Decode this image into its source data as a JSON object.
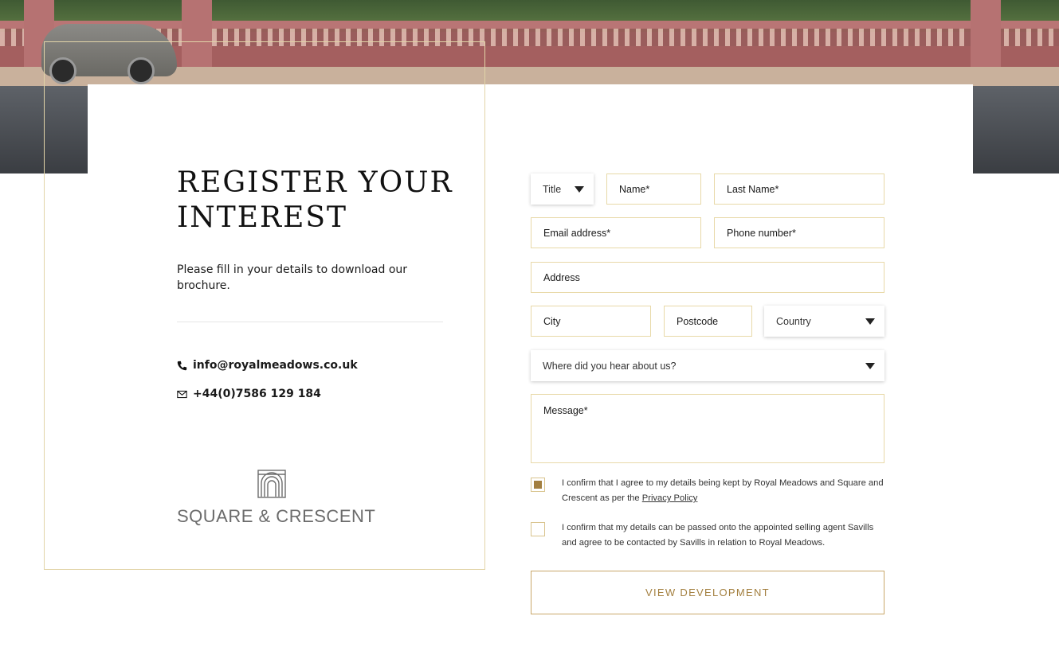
{
  "intro": {
    "heading_line1": "REGISTER YOUR",
    "heading_line2": "INTEREST",
    "text": "Please fill in your details to download our brochure."
  },
  "contacts": {
    "email": "info@royalmeadows.co.uk",
    "phone": "+44(0)7586 129 184"
  },
  "logo": {
    "text": "SQUARE & CRESCENT",
    "icon": "arch-logo-icon"
  },
  "form": {
    "title_select": "Title",
    "name_placeholder": "Name*",
    "last_name_placeholder": "Last Name*",
    "email_placeholder": "Email address*",
    "phone_placeholder": "Phone number*",
    "address_placeholder": "Address",
    "city_placeholder": "City",
    "postcode_placeholder": "Postcode",
    "country_select": "Country",
    "source_select": "Where did you hear about us?",
    "message_placeholder": "Message*",
    "consent1_text": "I confirm that I agree to my details being kept by Royal Meadows and Square and Crescent as per the",
    "consent1_link": "Privacy Policy",
    "consent1_checked": true,
    "consent2_text": "I confirm that my details can be passed onto the appointed selling agent Savills and agree to be contacted by Savills in relation to Royal Meadows.",
    "consent2_checked": false,
    "submit_label": "VIEW DEVELOPMENT"
  },
  "colors": {
    "accent": "#a37f3f",
    "border": "#e8d9a8",
    "text": "#1a1a1a"
  }
}
